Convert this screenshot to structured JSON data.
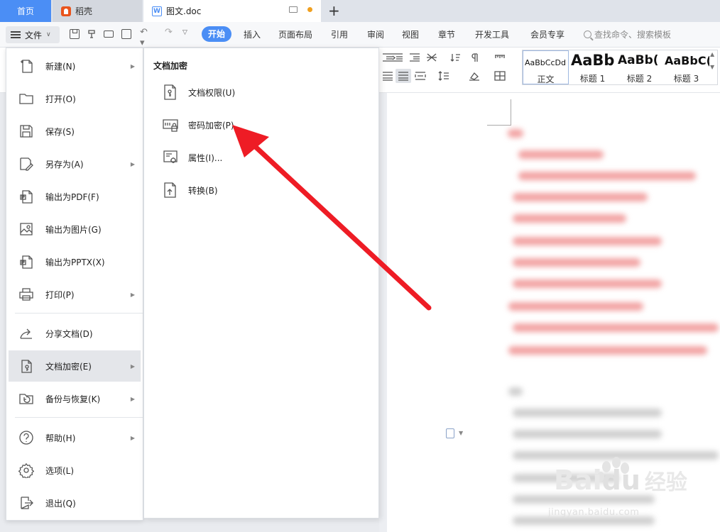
{
  "tabs": {
    "home": "首页",
    "daoke": "稻壳",
    "doc": "图文.doc"
  },
  "menu": {
    "file": "文件",
    "ribbon_tabs": [
      "开始",
      "插入",
      "页面布局",
      "引用",
      "审阅",
      "视图",
      "章节",
      "开发工具",
      "会员专享"
    ],
    "search_placeholder": "查找命令、搜索模板"
  },
  "styles": [
    {
      "preview": "AaBbCcDd",
      "label": "正文"
    },
    {
      "preview": "AaBb",
      "label": "标题 1"
    },
    {
      "preview": "AaBb(",
      "label": "标题 2"
    },
    {
      "preview": "AaBbC(",
      "label": "标题 3"
    }
  ],
  "file_menu": {
    "items": [
      {
        "label": "新建(N)",
        "icon": "new-document-icon",
        "submenu": true
      },
      {
        "label": "打开(O)",
        "icon": "folder-icon",
        "submenu": false
      },
      {
        "label": "保存(S)",
        "icon": "save-icon",
        "submenu": false
      },
      {
        "label": "另存为(A)",
        "icon": "save-as-icon",
        "submenu": true
      },
      {
        "label": "输出为PDF(F)",
        "icon": "pdf-icon",
        "submenu": false
      },
      {
        "label": "输出为图片(G)",
        "icon": "image-icon",
        "submenu": false
      },
      {
        "label": "输出为PPTX(X)",
        "icon": "pptx-icon",
        "submenu": false
      },
      {
        "label": "打印(P)",
        "icon": "print-icon",
        "submenu": true
      },
      {
        "label": "分享文档(D)",
        "icon": "share-icon",
        "submenu": false
      },
      {
        "label": "文档加密(E)",
        "icon": "encrypt-document-icon",
        "submenu": true
      },
      {
        "label": "备份与恢复(K)",
        "icon": "backup-icon",
        "submenu": true
      },
      {
        "label": "帮助(H)",
        "icon": "help-icon",
        "submenu": true
      },
      {
        "label": "选项(L)",
        "icon": "gear-icon",
        "submenu": false
      },
      {
        "label": "退出(Q)",
        "icon": "exit-icon",
        "submenu": false
      }
    ]
  },
  "submenu": {
    "title": "文档加密",
    "items": [
      {
        "label": "文档权限(U)",
        "icon": "document-permission-icon"
      },
      {
        "label": "密码加密(P)",
        "icon": "password-lock-icon"
      },
      {
        "label": "属性(I)...",
        "icon": "properties-icon"
      },
      {
        "label": "转换(B)",
        "icon": "convert-icon"
      }
    ]
  },
  "watermark": {
    "brand": "Bai",
    "brand2": "du",
    "brand_cn": "经验",
    "url": "jingyan.baidu.com"
  }
}
